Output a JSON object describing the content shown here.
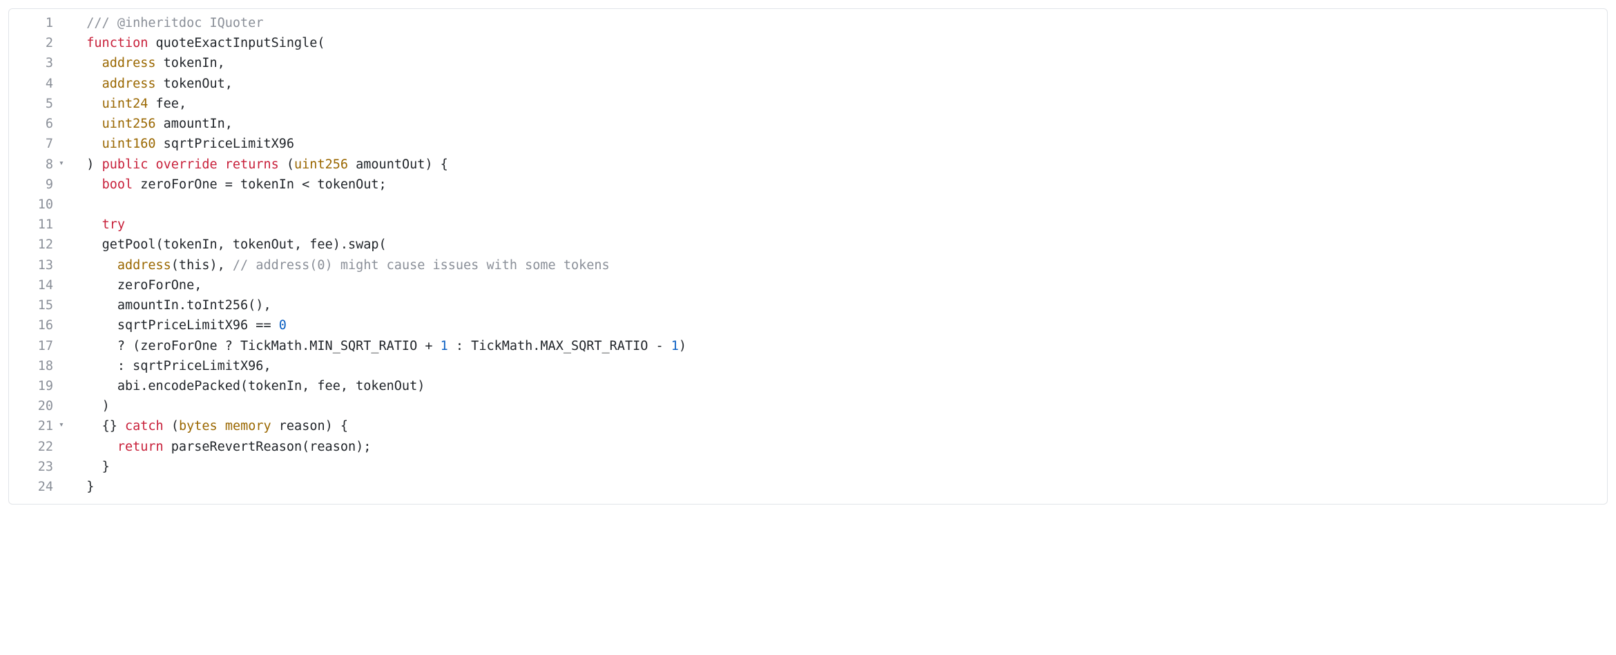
{
  "colors": {
    "border": "#e1e4e8",
    "gutter": "#8a8f98",
    "text": "#1f2328",
    "keyword": "#c8203a",
    "type": "#9a6700",
    "comment": "#8a8f98",
    "number": "#0a5fc2"
  },
  "fold_markers": {
    "8": "▾",
    "21": "▾"
  },
  "lines": [
    {
      "n": 1,
      "indent": 1,
      "tokens": [
        {
          "t": "/// @inheritdoc IQuoter",
          "c": "cm"
        }
      ]
    },
    {
      "n": 2,
      "indent": 1,
      "tokens": [
        {
          "t": "function",
          "c": "kw"
        },
        {
          "t": " quoteExactInputSingle("
        }
      ]
    },
    {
      "n": 3,
      "indent": 2,
      "tokens": [
        {
          "t": "address",
          "c": "type"
        },
        {
          "t": " tokenIn,"
        }
      ]
    },
    {
      "n": 4,
      "indent": 2,
      "tokens": [
        {
          "t": "address",
          "c": "type"
        },
        {
          "t": " tokenOut,"
        }
      ]
    },
    {
      "n": 5,
      "indent": 2,
      "tokens": [
        {
          "t": "uint24",
          "c": "type"
        },
        {
          "t": " fee,"
        }
      ]
    },
    {
      "n": 6,
      "indent": 2,
      "tokens": [
        {
          "t": "uint256",
          "c": "type"
        },
        {
          "t": " amountIn,"
        }
      ]
    },
    {
      "n": 7,
      "indent": 2,
      "tokens": [
        {
          "t": "uint160",
          "c": "type"
        },
        {
          "t": " sqrtPriceLimitX96"
        }
      ]
    },
    {
      "n": 8,
      "indent": 1,
      "tokens": [
        {
          "t": ") "
        },
        {
          "t": "public",
          "c": "kw"
        },
        {
          "t": " "
        },
        {
          "t": "override",
          "c": "kw"
        },
        {
          "t": " "
        },
        {
          "t": "returns",
          "c": "kw"
        },
        {
          "t": " ("
        },
        {
          "t": "uint256",
          "c": "type"
        },
        {
          "t": " amountOut) {"
        }
      ]
    },
    {
      "n": 9,
      "indent": 2,
      "tokens": [
        {
          "t": "bool",
          "c": "kw"
        },
        {
          "t": " zeroForOne = tokenIn < tokenOut;"
        }
      ]
    },
    {
      "n": 10,
      "indent": 0,
      "tokens": [
        {
          "t": ""
        }
      ]
    },
    {
      "n": 11,
      "indent": 2,
      "tokens": [
        {
          "t": "try",
          "c": "kw"
        }
      ]
    },
    {
      "n": 12,
      "indent": 2,
      "tokens": [
        {
          "t": "getPool(tokenIn, tokenOut, fee).swap("
        }
      ]
    },
    {
      "n": 13,
      "indent": 3,
      "tokens": [
        {
          "t": "address",
          "c": "type"
        },
        {
          "t": "(this), "
        },
        {
          "t": "// address(0) might cause issues with some tokens",
          "c": "cm"
        }
      ]
    },
    {
      "n": 14,
      "indent": 3,
      "tokens": [
        {
          "t": "zeroForOne,"
        }
      ]
    },
    {
      "n": 15,
      "indent": 3,
      "tokens": [
        {
          "t": "amountIn.toInt256(),"
        }
      ]
    },
    {
      "n": 16,
      "indent": 3,
      "tokens": [
        {
          "t": "sqrtPriceLimitX96 == "
        },
        {
          "t": "0",
          "c": "num"
        }
      ]
    },
    {
      "n": 17,
      "indent": 3,
      "tokens": [
        {
          "t": "? (zeroForOne ? TickMath.MIN_SQRT_RATIO + "
        },
        {
          "t": "1",
          "c": "num"
        },
        {
          "t": " : TickMath.MAX_SQRT_RATIO - "
        },
        {
          "t": "1",
          "c": "num"
        },
        {
          "t": ")"
        }
      ]
    },
    {
      "n": 18,
      "indent": 3,
      "tokens": [
        {
          "t": ": sqrtPriceLimitX96,"
        }
      ]
    },
    {
      "n": 19,
      "indent": 3,
      "tokens": [
        {
          "t": "abi.encodePacked(tokenIn, fee, tokenOut)"
        }
      ]
    },
    {
      "n": 20,
      "indent": 2,
      "tokens": [
        {
          "t": ")"
        }
      ]
    },
    {
      "n": 21,
      "indent": 2,
      "tokens": [
        {
          "t": "{} "
        },
        {
          "t": "catch",
          "c": "kw"
        },
        {
          "t": " ("
        },
        {
          "t": "bytes",
          "c": "type"
        },
        {
          "t": " "
        },
        {
          "t": "memory",
          "c": "type"
        },
        {
          "t": " reason) {"
        }
      ]
    },
    {
      "n": 22,
      "indent": 3,
      "tokens": [
        {
          "t": "return",
          "c": "kw"
        },
        {
          "t": " parseRevertReason(reason);"
        }
      ]
    },
    {
      "n": 23,
      "indent": 2,
      "tokens": [
        {
          "t": "}"
        }
      ]
    },
    {
      "n": 24,
      "indent": 1,
      "tokens": [
        {
          "t": "}"
        }
      ]
    }
  ],
  "indent_unit": "  "
}
